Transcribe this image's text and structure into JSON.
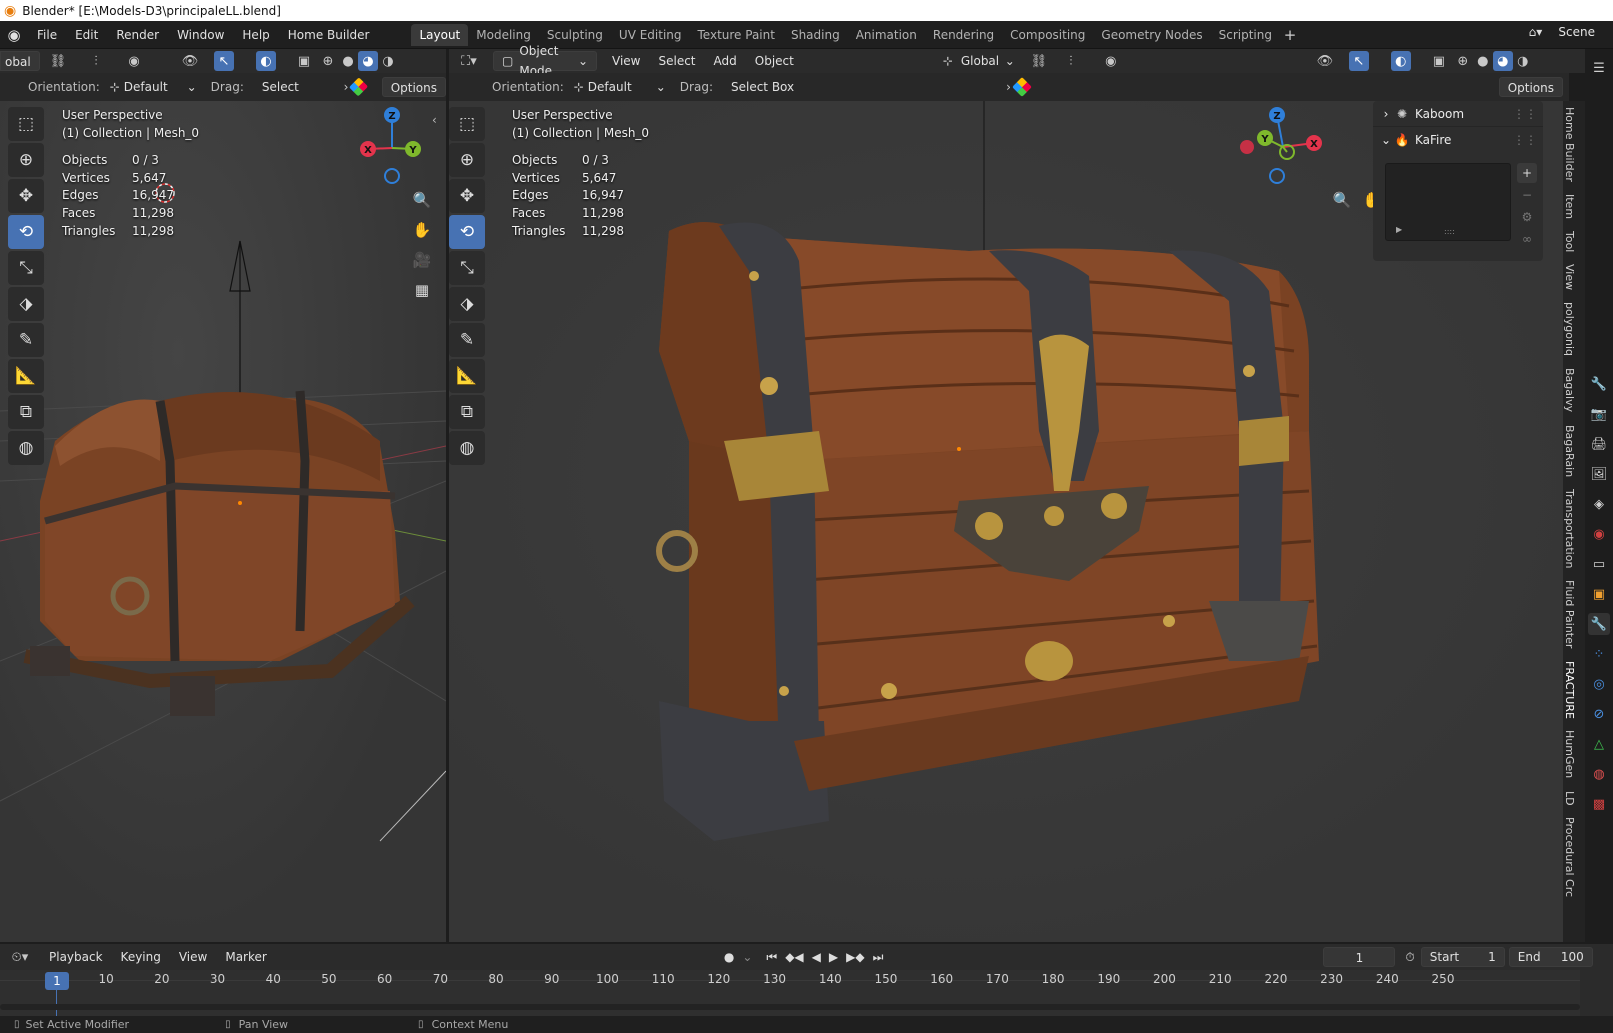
{
  "title_bar": {
    "title": "Blender* [E:\\Models-D3\\principaleLL.blend]"
  },
  "menu": [
    "File",
    "Edit",
    "Render",
    "Window",
    "Help",
    "Home Builder"
  ],
  "workspaces": [
    "Layout",
    "Modeling",
    "Sculpting",
    "UV Editing",
    "Texture Paint",
    "Shading",
    "Animation",
    "Rendering",
    "Compositing",
    "Geometry Nodes",
    "Scripting"
  ],
  "active_workspace": "Layout",
  "scene_label": "Scene",
  "left_view": {
    "header_global": "obal",
    "orientation_label": "Orientation:",
    "orientation_value": "Default",
    "drag_label": "Drag:",
    "drag_value": "Select Box",
    "options_label": "Options",
    "overlay_title": "User Perspective",
    "overlay_collection": "(1) Collection | Mesh_0",
    "stats": [
      {
        "label": "Objects",
        "value": "0 / 3"
      },
      {
        "label": "Vertices",
        "value": "5,647"
      },
      {
        "label": "Edges",
        "value": "16,947"
      },
      {
        "label": "Faces",
        "value": "11,298"
      },
      {
        "label": "Triangles",
        "value": "11,298"
      }
    ]
  },
  "right_view": {
    "mode": "Object Mode",
    "menu": [
      "View",
      "Select",
      "Add",
      "Object"
    ],
    "transform_orientation": "Global",
    "orientation_label": "Orientation:",
    "orientation_value": "Default",
    "drag_label": "Drag:",
    "drag_value": "Select Box",
    "options_label": "Options",
    "overlay_title": "User Perspective",
    "overlay_collection": "(1) Collection | Mesh_0",
    "stats": [
      {
        "label": "Objects",
        "value": "0 / 3"
      },
      {
        "label": "Vertices",
        "value": "5,647"
      },
      {
        "label": "Edges",
        "value": "16,947"
      },
      {
        "label": "Faces",
        "value": "11,298"
      },
      {
        "label": "Triangles",
        "value": "11,298"
      }
    ]
  },
  "n_panel": {
    "sections": [
      {
        "label": "Kaboom",
        "expanded": false
      },
      {
        "label": "KaFire",
        "expanded": true
      }
    ],
    "tabs": [
      "Home Builder",
      "Item",
      "Tool",
      "View",
      "polygoniq",
      "Bagalvy",
      "BagaRain",
      "Transportation",
      "Fluid Painter",
      "FRACTURE",
      "HumGen",
      "LD",
      "Procedural Crc"
    ]
  },
  "axes": {
    "x": "X",
    "y": "Y",
    "z": "Z"
  },
  "timeline": {
    "menu": [
      "Playback",
      "Keying",
      "View",
      "Marker"
    ],
    "current_frame": "1",
    "start_label": "Start",
    "start_value": "1",
    "end_label": "End",
    "end_value": "100",
    "ticks": [
      "1",
      "10",
      "20",
      "30",
      "40",
      "50",
      "60",
      "70",
      "80",
      "90",
      "100",
      "110",
      "120",
      "130",
      "140",
      "150",
      "160",
      "170",
      "180",
      "190",
      "200",
      "210",
      "220",
      "230",
      "240",
      "250"
    ]
  },
  "status_bar": [
    "Set Active Modifier",
    "Pan View",
    "Context Menu"
  ],
  "colors": {
    "accent": "#4772b3",
    "axis_x": "#e4344c",
    "axis_y": "#7fb82c",
    "axis_z": "#2f7fd9",
    "wood": "#8a4b28",
    "iron": "#3c3d42",
    "brass": "#b8943e"
  }
}
